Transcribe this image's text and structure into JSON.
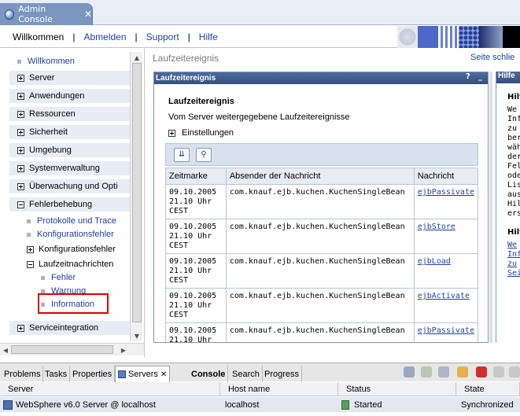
{
  "editor": {
    "tab_title": "Admin Console",
    "close_glyph": "✕",
    "icon": "globe-icon"
  },
  "topnav": {
    "items": [
      "Willkommen",
      "Abmelden",
      "Support",
      "Hilfe"
    ],
    "separator": "|"
  },
  "leftnav": {
    "items": [
      {
        "label": "Willkommen",
        "kind": "bullet-link"
      },
      {
        "label": "Server",
        "kind": "plus"
      },
      {
        "label": "Anwendungen",
        "kind": "plus"
      },
      {
        "label": "Ressourcen",
        "kind": "plus"
      },
      {
        "label": "Sicherheit",
        "kind": "plus"
      },
      {
        "label": "Umgebung",
        "kind": "plus"
      },
      {
        "label": "Systemverwaltung",
        "kind": "plus"
      },
      {
        "label": "Überwachung und Opti",
        "kind": "plus"
      },
      {
        "label": "Fehlerbehebung",
        "kind": "minus"
      },
      {
        "label": "Protokolle und Trace",
        "kind": "bullet-link"
      },
      {
        "label": "Konfigurationsfehler",
        "kind": "bullet-link"
      },
      {
        "label": "Konfigurationsfehler",
        "kind": "plus-sub"
      },
      {
        "label": "Laufzeitnachrichten",
        "kind": "minus-sub"
      },
      {
        "label": "Fehler",
        "kind": "bullet-link-2"
      },
      {
        "label": "Warnung",
        "kind": "bullet-link-2"
      },
      {
        "label": "Information",
        "kind": "bullet-link-2"
      },
      {
        "label": "Serviceintegration",
        "kind": "plus"
      }
    ]
  },
  "main": {
    "breadcrumb": "Laufzeitereignis",
    "page_link": "Seite schlie",
    "panel": {
      "header": "Laufzeitereignis",
      "help_glyph": "?",
      "minimize_glyph": "_",
      "title": "Laufzeitereignis",
      "description": "Vom Server weitergegebene Laufzeitereignisse",
      "settings_label": "Einstellungen"
    },
    "table": {
      "headers": [
        "Zeitmarke",
        "Absender der Nachricht",
        "Nachricht"
      ],
      "rows": [
        {
          "time1": "09.10.2005",
          "time2": "21.10 Uhr",
          "time3": "CEST",
          "sender": "com.knauf.ejb.kuchen.KuchenSingleBean",
          "message": "ejbPassivate"
        },
        {
          "time1": "09.10.2005",
          "time2": "21.10 Uhr",
          "time3": "CEST",
          "sender": "com.knauf.ejb.kuchen.KuchenSingleBean",
          "message": "ejbStore"
        },
        {
          "time1": "09.10.2005",
          "time2": "21.10 Uhr",
          "time3": "CEST",
          "sender": "com.knauf.ejb.kuchen.KuchenSingleBean",
          "message": "ejbLoad"
        },
        {
          "time1": "09.10.2005",
          "time2": "21.10 Uhr",
          "time3": "CEST",
          "sender": "com.knauf.ejb.kuchen.KuchenSingleBean",
          "message": "ejbActivate"
        },
        {
          "time1": "09.10.2005",
          "time2": "21.10 Uhr",
          "time3": "",
          "sender": "com.knauf.ejb.kuchen.KuchenSingleBean",
          "message": "ejbPassivate"
        }
      ]
    }
  },
  "help": {
    "header": "Hilfe",
    "bold1": "Hilf",
    "lines": [
      "We",
      "Inf",
      "zu",
      "ber",
      "wäh",
      "der",
      "Fel",
      "ode",
      "Lis",
      "aus",
      "Hil",
      "ers"
    ],
    "bold2": "Hilf",
    "links": [
      "We",
      "Inf",
      "zu",
      "Sei"
    ]
  },
  "bottom": {
    "tabs": [
      "Problems",
      "Tasks",
      "Properties",
      "Servers",
      "Console",
      "Search",
      "Progress"
    ],
    "active_tab": "Servers",
    "close_glyph": "✕",
    "servers": {
      "headers": [
        "Server",
        "Host name",
        "Status",
        "State"
      ],
      "row": {
        "server": "WebSphere v6.0 Server @ localhost",
        "host": "localhost",
        "status": "Started",
        "state": "Synchronized"
      }
    }
  },
  "colors": {
    "accent": "#33507f",
    "link": "#1f3fa0",
    "highlight": "#e00000"
  }
}
